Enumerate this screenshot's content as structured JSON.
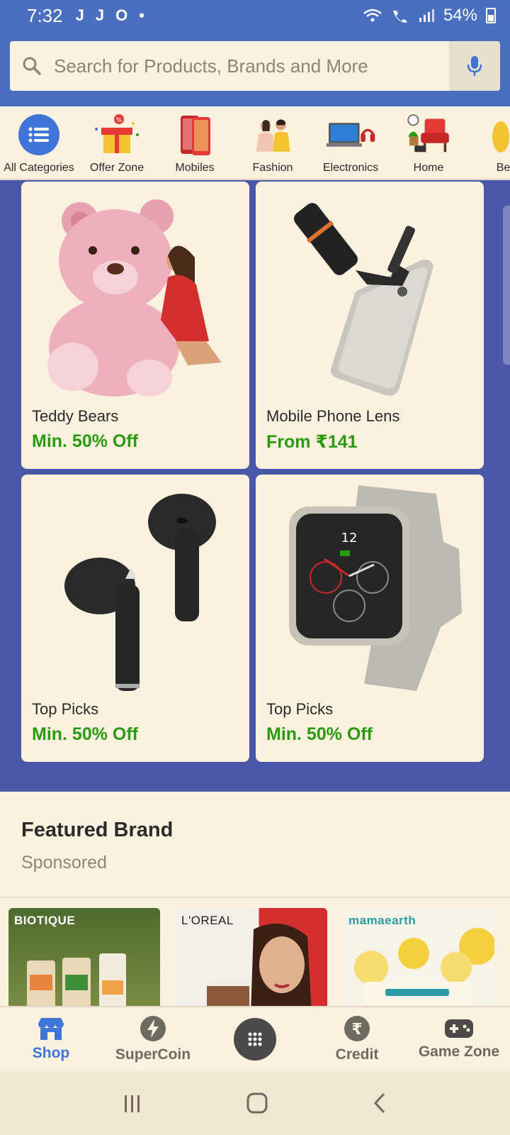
{
  "status_bar": {
    "time": "7:32",
    "left_icons": [
      "J",
      "J",
      "O",
      "•"
    ],
    "battery": "54%"
  },
  "search": {
    "placeholder": "Search for Products, Brands and More"
  },
  "categories": [
    {
      "label": "All Categories",
      "icon": "menu-icon"
    },
    {
      "label": "Offer Zone",
      "icon": "gift-icon"
    },
    {
      "label": "Mobiles",
      "icon": "phone-icon"
    },
    {
      "label": "Fashion",
      "icon": "fashion-icon"
    },
    {
      "label": "Electronics",
      "icon": "laptop-icon"
    },
    {
      "label": "Home",
      "icon": "chair-icon"
    },
    {
      "label": "Bea",
      "icon": "beauty-icon"
    }
  ],
  "promo_cards": [
    {
      "title": "Teddy Bears",
      "offer": "Min. 50% Off"
    },
    {
      "title": "Mobile Phone Lens",
      "offer": "From ₹141"
    },
    {
      "title": "Top Picks",
      "offer": "Min. 50% Off"
    },
    {
      "title": "Top Picks",
      "offer": "Min. 50% Off"
    }
  ],
  "featured": {
    "title": "Featured Brand",
    "subtitle": "Sponsored"
  },
  "brands": [
    "BIOTIQUE",
    "L'OREAL",
    "mamaearth"
  ],
  "bottom_nav": [
    {
      "label": "Shop",
      "icon": "shop-icon"
    },
    {
      "label": "SuperCoin",
      "icon": "lightning-icon"
    },
    {
      "label": "",
      "icon": "grid-icon"
    },
    {
      "label": "Credit",
      "icon": "rupee-icon"
    },
    {
      "label": "Game Zone",
      "icon": "gamepad-icon"
    }
  ],
  "colors": {
    "header_blue": "#4a6fc0",
    "promo_bg": "#4b57a7",
    "offer_green": "#2a9a12",
    "active_blue": "#3f74d8",
    "cream": "#fbf1df"
  }
}
